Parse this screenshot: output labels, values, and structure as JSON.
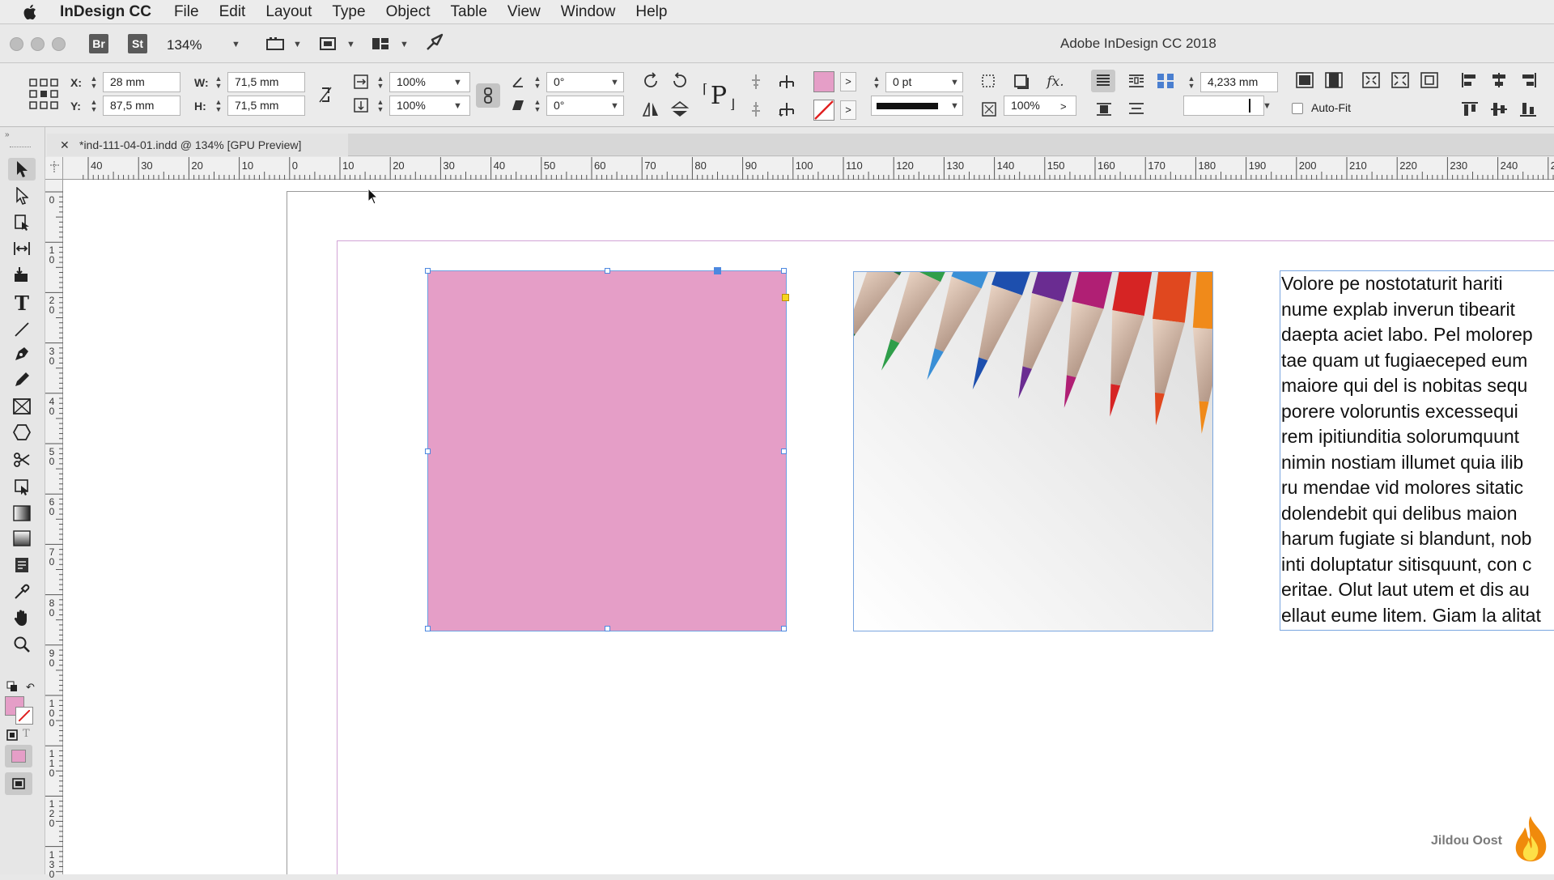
{
  "menubar": {
    "app_name": "InDesign CC",
    "items": [
      "File",
      "Edit",
      "Layout",
      "Type",
      "Object",
      "Table",
      "View",
      "Window",
      "Help"
    ]
  },
  "appbar": {
    "bridge_label": "Br",
    "stock_label": "St",
    "zoom": "134%",
    "window_title": "Adobe InDesign CC 2018"
  },
  "control": {
    "x_label": "X:",
    "x_value": "28 mm",
    "y_label": "Y:",
    "y_value": "87,5 mm",
    "w_label": "W:",
    "w_value": "71,5 mm",
    "h_label": "H:",
    "h_value": "71,5 mm",
    "scale_x": "100%",
    "scale_y": "100%",
    "rotate": "0°",
    "shear": "0°",
    "stroke_weight": "0 pt",
    "opacity": "100%",
    "spacing": "4,233 mm",
    "autofit_label": "Auto-Fit",
    "fill_color": "#e59ec7"
  },
  "document": {
    "tab_title": "*ind-111-04-01.indd @ 134% [GPU Preview]"
  },
  "rulers": {
    "h_labels": [
      "40",
      "30",
      "20",
      "10",
      "0",
      "10",
      "20",
      "30",
      "40",
      "50",
      "60",
      "70",
      "80",
      "90",
      "100",
      "110",
      "120",
      "130",
      "140",
      "150",
      "160",
      "170",
      "180",
      "190",
      "200",
      "210",
      "220",
      "230",
      "240",
      "2"
    ],
    "v_labels": [
      "0",
      "1 0",
      "2 0",
      "3 0",
      "4 0",
      "5 0",
      "6 0",
      "7 0",
      "8 0",
      "9 0",
      "1 0 0",
      "1 1 0",
      "1 2 0",
      "1 3 0"
    ]
  },
  "canvas": {
    "rect_fill": "#e59ec7",
    "text_lines": [
      "Volore pe nostotaturit hariti",
      "nume explab inverun tibearit",
      "daepta aciet labo. Pel molorep",
      "tae quam ut fugiaeceped eum",
      "maiore qui del is nobitas sequ",
      "porere voloruntis excessequi",
      "rem ipitiunditia solorumquunt",
      "nimin nostiam illumet quia ilib",
      "ru mendae vid molores sitatic",
      "dolendebit qui delibus maion",
      "harum fugiate si blandunt, nob",
      "inti doluptatur sitisquunt, con c",
      "eritae. Olut laut utem et dis au",
      "ellaut eume litem. Giam la alitat"
    ]
  },
  "watermark": {
    "text": "Jildou Oost"
  }
}
